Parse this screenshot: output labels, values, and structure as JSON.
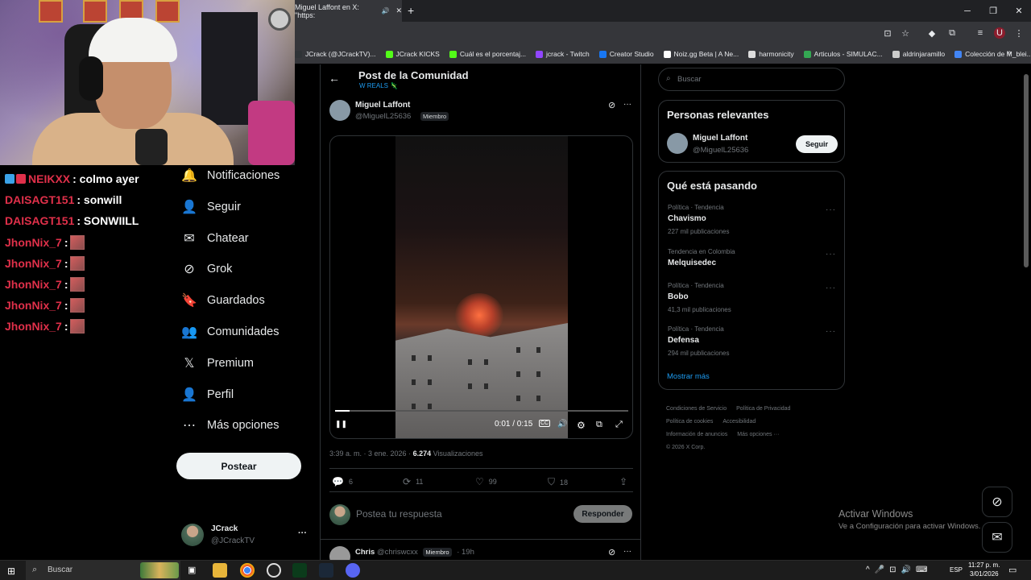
{
  "browser": {
    "tab_title": "Miguel Laffont en X: \"https:",
    "new_tab": "+",
    "window_controls": {
      "minimize": "─",
      "restore": "❐",
      "close": "✕"
    },
    "bookmarks": [
      {
        "label": "JCrack (@JCrackTV)...",
        "color": "#2f3336"
      },
      {
        "label": "JCrack KICKS",
        "color": "#53fc18"
      },
      {
        "label": "Cuál es el porcentaj...",
        "color": "#53fc18"
      },
      {
        "label": "jcrack - Twitch",
        "color": "#9146ff"
      },
      {
        "label": "Creator Studio",
        "color": "#1877f2"
      },
      {
        "label": "Noiz.gg Beta | A Ne...",
        "color": "#ffffff"
      },
      {
        "label": "harmonicity",
        "color": "#dddddd"
      },
      {
        "label": "Articulos - SIMULAC...",
        "color": "#34a853"
      },
      {
        "label": "aldrinjaramillo",
        "color": "#cccccc"
      },
      {
        "label": "Colección de M_blei...",
        "color": "#4285f4"
      }
    ]
  },
  "chat": {
    "lines": [
      {
        "user": "NEIKXX",
        "msg": ": colmo ayer",
        "badges": true,
        "emote": false
      },
      {
        "user": "DAISAGT151",
        "msg": ": sonwill",
        "badges": false,
        "emote": false
      },
      {
        "user": "DAISAGT151",
        "msg": ": SONWIILL",
        "badges": false,
        "emote": false
      },
      {
        "user": "JhonNix_7",
        "msg": " :",
        "badges": false,
        "emote": true
      },
      {
        "user": "JhonNix_7",
        "msg": " :",
        "badges": false,
        "emote": true
      },
      {
        "user": "JhonNix_7",
        "msg": " :",
        "badges": false,
        "emote": true
      },
      {
        "user": "JhonNix_7",
        "msg": " :",
        "badges": false,
        "emote": true
      },
      {
        "user": "JhonNix_7",
        "msg": " :",
        "badges": false,
        "emote": true
      }
    ]
  },
  "nav": {
    "items": [
      {
        "label": "Notificaciones",
        "icon": "bell-icon",
        "glyph": "🔔"
      },
      {
        "label": "Seguir",
        "icon": "add-person-icon",
        "glyph": "👤"
      },
      {
        "label": "Chatear",
        "icon": "envelope-icon",
        "glyph": "✉"
      },
      {
        "label": "Grok",
        "icon": "grok-icon",
        "glyph": "⊘"
      },
      {
        "label": "Guardados",
        "icon": "bookmark-icon",
        "glyph": "🔖"
      },
      {
        "label": "Comunidades",
        "icon": "people-icon",
        "glyph": "👥"
      },
      {
        "label": "Premium",
        "icon": "x-logo-icon",
        "glyph": "𝕏"
      },
      {
        "label": "Perfil",
        "icon": "person-icon",
        "glyph": "👤"
      },
      {
        "label": "Más opciones",
        "icon": "more-circle-icon",
        "glyph": "⋯"
      }
    ],
    "post_button": "Postear",
    "profile": {
      "name": "JCrack",
      "handle": "@JCrackTV",
      "more": "···"
    }
  },
  "header": {
    "title": "Post de la Comunidad",
    "community": "W REALS 🦎",
    "back": "←"
  },
  "post": {
    "author_name": "Miguel Laffont",
    "author_handle": "@MiguelL25636",
    "member_badge": "Miembro",
    "more": "···",
    "timestamp": "3:39 a. m. · 3 ene. 2026 · ",
    "views_count": "6.274",
    "views_label": " Visualizaciones",
    "video": {
      "time": "0:01 / 0:15",
      "progress": 0.05,
      "pause": "❚❚",
      "cc": "CC",
      "volume": "🔊",
      "settings": "⚙",
      "miniplayer": "⧉",
      "fullscreen": "⤢"
    },
    "actions": {
      "replies": "6",
      "reposts": "11",
      "likes": "99",
      "bookmarks": "18"
    },
    "reply_placeholder": "Postea tu respuesta",
    "reply_button": "Responder"
  },
  "next_reply": {
    "name": "Chris",
    "handle": "@chriswcxx",
    "badge": "Miembro",
    "time": "· 19h",
    "more": "···"
  },
  "right": {
    "search_placeholder": "Buscar",
    "relevant": {
      "title": "Personas relevantes",
      "name": "Miguel Laffont",
      "handle": "@MiguelL25636",
      "follow": "Seguir"
    },
    "trending": {
      "title": "Qué está pasando",
      "items": [
        {
          "meta": "Política · Tendencia",
          "name": "Chavismo",
          "count": "227 mil publicaciones"
        },
        {
          "meta": "Tendencia en Colombia",
          "name": "Melquisedec",
          "count": ""
        },
        {
          "meta": "Política · Tendencia",
          "name": "Bobo",
          "count": "41,3 mil publicaciones"
        },
        {
          "meta": "Política · Tendencia",
          "name": "Defensa",
          "count": "294 mil publicaciones"
        }
      ],
      "show_more": "Mostrar más"
    },
    "footer": {
      "links": [
        "Condiciones de Servicio",
        "Política de Privacidad",
        "Política de cookies",
        "Accesibilidad",
        "Información de anuncios",
        "Más opciones ···"
      ],
      "copyright": "© 2026 X Corp."
    }
  },
  "watermark": {
    "line1": "Activar Windows",
    "line2": "Ve a Configuración para activar Windows."
  },
  "taskbar": {
    "search_placeholder": "Buscar",
    "lang": "ESP",
    "time": "11:27 p. m.",
    "date": "3/01/2026"
  },
  "colors": {
    "accent": "#1d9bf0",
    "chat_user": "#e0304a",
    "bg": "#000000"
  }
}
